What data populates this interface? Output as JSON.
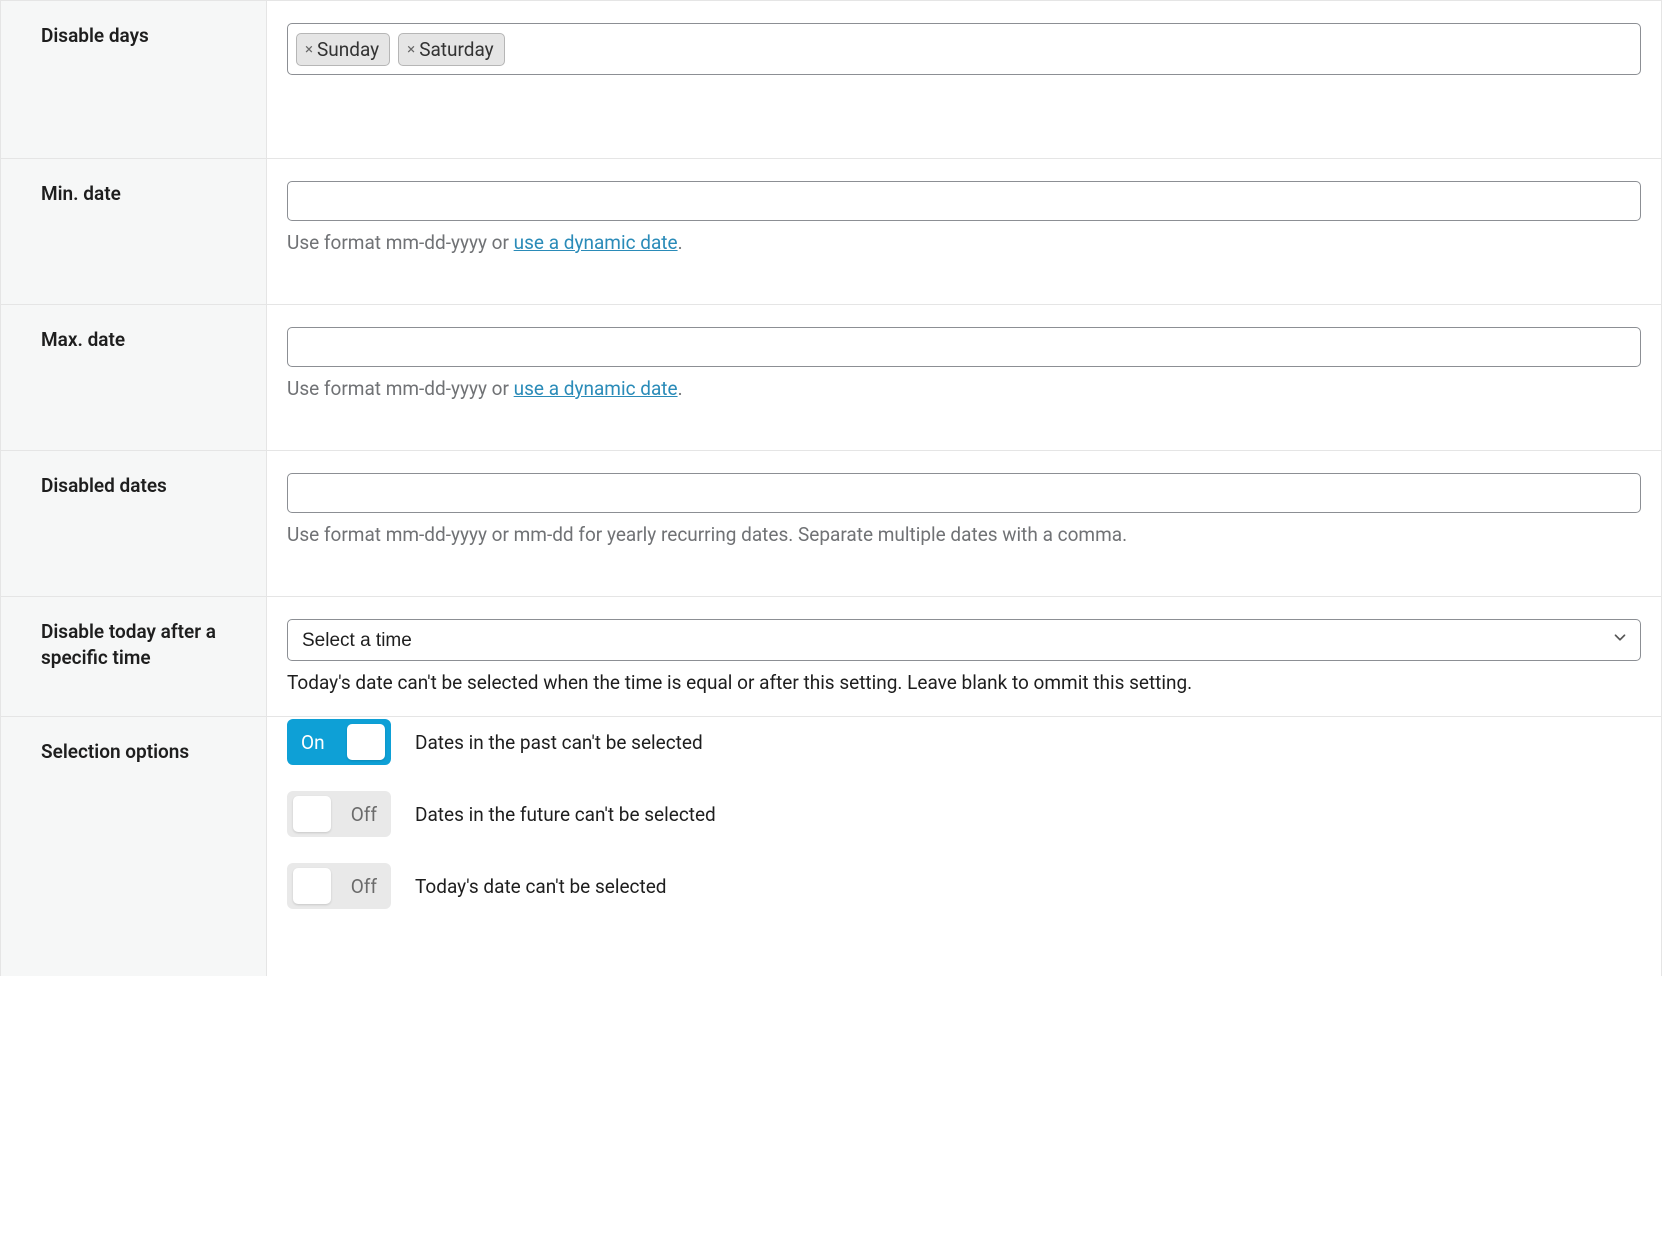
{
  "rows": {
    "disable_days": {
      "label": "Disable days",
      "tags": [
        {
          "label": "Sunday"
        },
        {
          "label": "Saturday"
        }
      ]
    },
    "min_date": {
      "label": "Min. date",
      "value": "",
      "helper_prefix": "Use format mm-dd-yyyy or ",
      "helper_link": "use a dynamic date",
      "helper_suffix": "."
    },
    "max_date": {
      "label": "Max. date",
      "value": "",
      "helper_prefix": "Use format mm-dd-yyyy or ",
      "helper_link": "use a dynamic date",
      "helper_suffix": "."
    },
    "disabled_dates": {
      "label": "Disabled dates",
      "value": "",
      "helper": "Use format mm-dd-yyyy or mm-dd for yearly recurring dates. Separate multiple dates with a comma."
    },
    "disable_today": {
      "label": "Disable today after a specific time",
      "placeholder": "Select a time",
      "helper": "Today's date can't be selected when the time is equal or after this setting. Leave blank to ommit this setting."
    },
    "selection_options": {
      "label": "Selection options",
      "toggles": [
        {
          "state": "on",
          "state_label": "On",
          "text": "Dates in the past can't be selected"
        },
        {
          "state": "off",
          "state_label": "Off",
          "text": "Dates in the future can't be selected"
        },
        {
          "state": "off",
          "state_label": "Off",
          "text": "Today's date can't be selected"
        }
      ]
    }
  }
}
